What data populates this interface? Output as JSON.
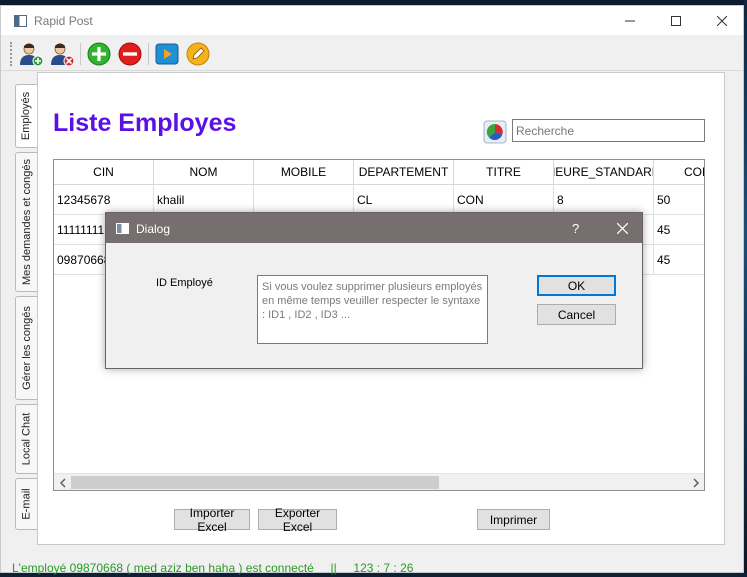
{
  "window": {
    "title": "Rapid Post",
    "controls": [
      "minimize",
      "maximize",
      "close"
    ]
  },
  "toolbar": {
    "buttons": [
      {
        "name": "add-employee",
        "icon": "user-add-icon"
      },
      {
        "name": "remove-employee",
        "icon": "user-remove-icon"
      },
      {
        "name": "add",
        "icon": "plus-circle-icon"
      },
      {
        "name": "remove",
        "icon": "minus-circle-icon"
      },
      {
        "name": "play",
        "icon": "play-icon"
      },
      {
        "name": "edit",
        "icon": "pencil-icon"
      }
    ]
  },
  "side_tabs": [
    {
      "label": "Employés",
      "active": true
    },
    {
      "label": "Mes demandes et congés",
      "active": false
    },
    {
      "label": "Gérer les congés",
      "active": false
    },
    {
      "label": "Local Chat",
      "active": false
    },
    {
      "label": "E-mail",
      "active": false
    }
  ],
  "page": {
    "title": "Liste Employes"
  },
  "search": {
    "placeholder": "Recherche",
    "value": ""
  },
  "table": {
    "columns": [
      "CIN",
      "NOM",
      "MOBILE",
      "DEPARTEMENT",
      "TITRE",
      "HEURE_STANDARD",
      "CON"
    ],
    "rows": [
      [
        "12345678",
        "khalil",
        "",
        "CL",
        "CON",
        "8",
        "50"
      ],
      [
        "11111111",
        "",
        "",
        "",
        "",
        "",
        "45"
      ],
      [
        "09870668",
        "",
        "",
        "",
        "",
        "",
        "45"
      ]
    ]
  },
  "buttons": {
    "import": "Importer Excel",
    "export": "Exporter  Excel",
    "print": "Imprimer"
  },
  "status": {
    "text": "L'employé 09870668 ( med aziz ben haha ) est connecté     ||     123 : 7 : 26"
  },
  "dialog": {
    "title": "Dialog",
    "help": "?",
    "label": "ID Employé",
    "input_placeholder": "Si vous voulez supprimer plusieurs employés en même temps veuiller respecter le syntaxe : ID1 , ID2 , ID3 ...",
    "ok": "OK",
    "cancel": "Cancel"
  },
  "colors": {
    "heading": "#5a10e6",
    "status": "#2a9a2a",
    "dialog_title_bg": "#776e6f",
    "ok_border": "#0078d7"
  }
}
